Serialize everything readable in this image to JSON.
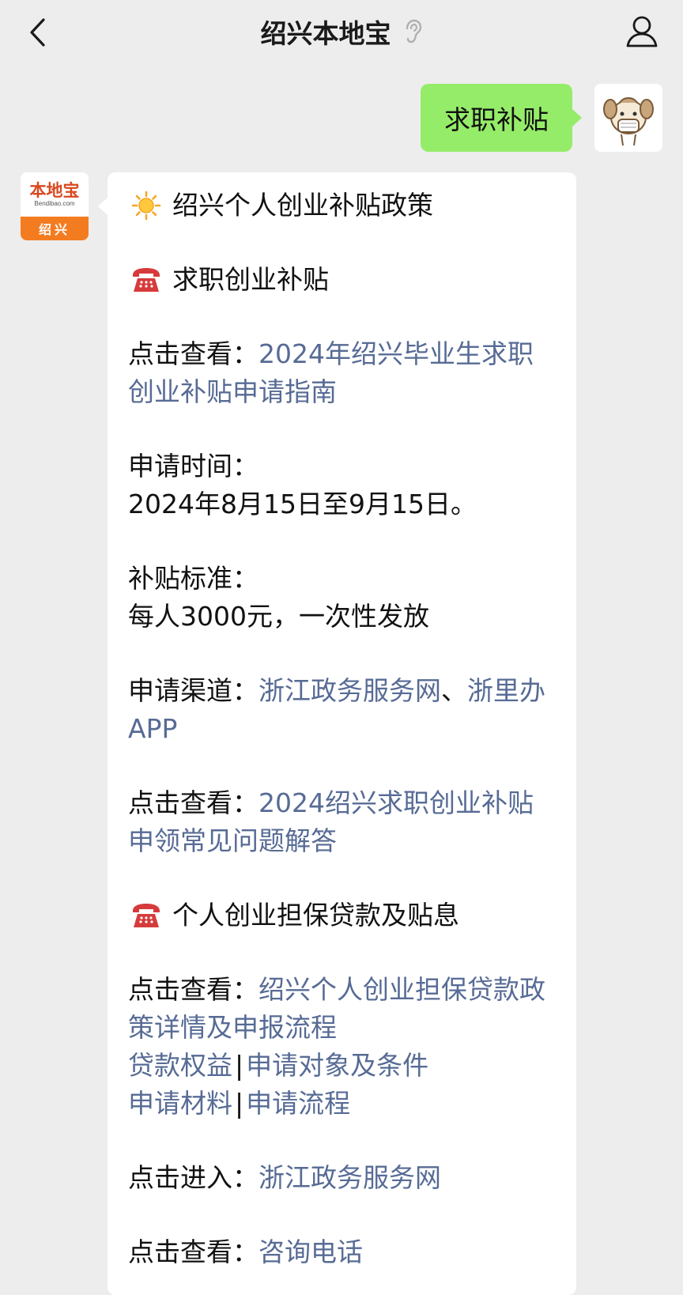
{
  "header": {
    "title": "绍兴本地宝",
    "back_icon": "chevron-left-icon",
    "ear_icon": "ear-icon",
    "profile_icon": "person-icon"
  },
  "user_message": {
    "text": "求职补贴",
    "bubble_color": "#95ec69"
  },
  "bot": {
    "avatar_logo": "本地宝",
    "avatar_url": "Bendibao.com",
    "avatar_city": "绍兴"
  },
  "reply": {
    "title": "绍兴个人创业补贴政策",
    "section1": {
      "heading": "求职创业补贴",
      "view_label": "点击查看：",
      "guide_link": "2024年绍兴毕业生求职创业补贴申请指南",
      "time_label": "申请时间：",
      "time_value": "2024年8月15日至9月15日。",
      "standard_label": "补贴标准：",
      "standard_value": "每人3000元，一次性发放",
      "channel_label": "申请渠道：",
      "channel_link_1": "浙江政务服务网",
      "channel_sep": "、",
      "channel_link_2": "浙里办APP",
      "faq_label": "点击查看：",
      "faq_link": "2024绍兴求职创业补贴申领常见问题解答"
    },
    "section2": {
      "heading": "个人创业担保贷款及贴息",
      "view_label": "点击查看：",
      "policy_link": "绍兴个人创业担保贷款政策详情及申报流程",
      "link_rights": "贷款权益",
      "link_eligibility": "申请对象及条件",
      "link_materials": "申请材料",
      "link_process": "申请流程",
      "separator": "|",
      "enter_label": "点击进入：",
      "enter_link": "浙江政务服务网",
      "phone_label": "点击查看：",
      "phone_link": "咨询电话"
    },
    "link_color": "#576b95"
  }
}
